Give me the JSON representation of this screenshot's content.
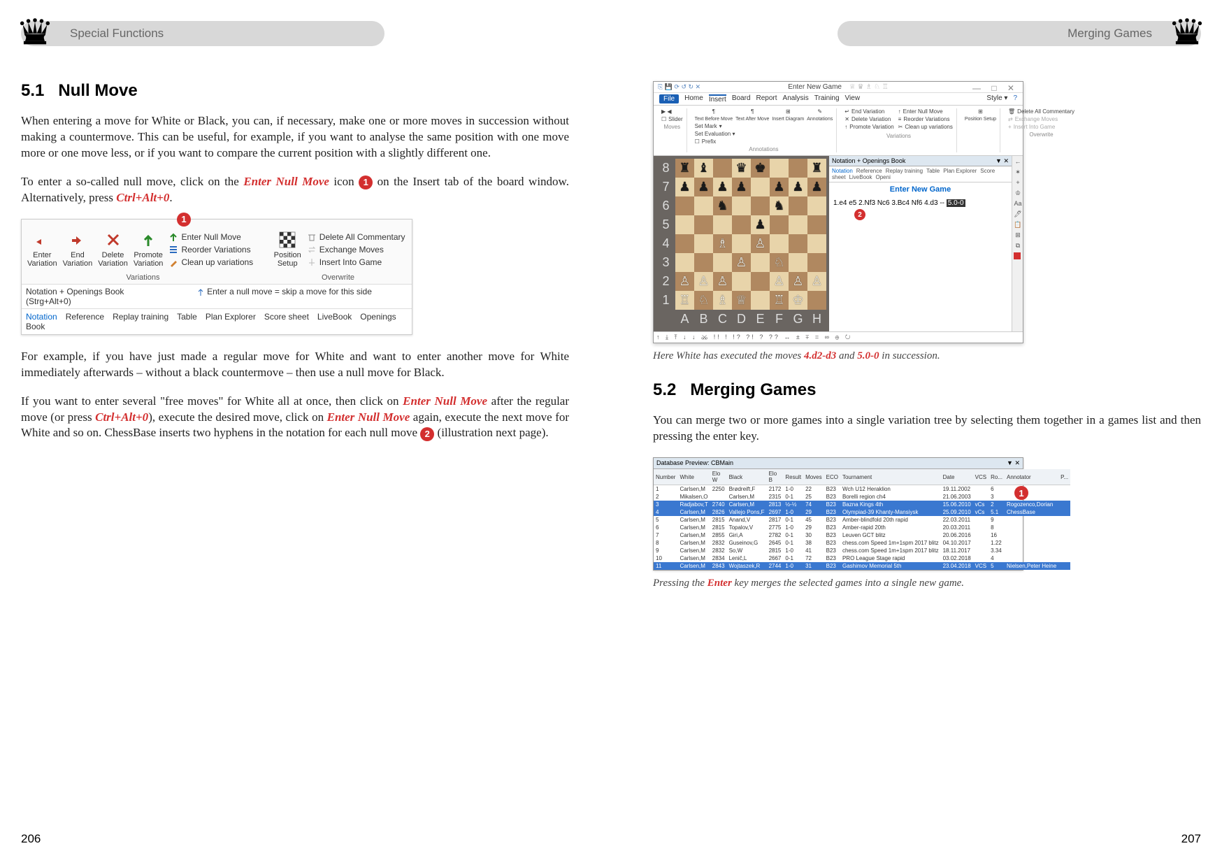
{
  "header_left": "Special Functions",
  "header_right": "Merging Games",
  "page_left": "206",
  "page_right": "207",
  "s51": {
    "num": "5.1",
    "title": "Null Move",
    "p1": "When entering a move for White or Black, you can, if necessary, make one or more moves in succession without making a countermove. This can be useful, for example, if you want to analyse the same position with one move more or one move less, or if you want to compare the current position with a slightly different one.",
    "p2_a": "To enter a so-called null move, click on the ",
    "p2_em1": "Enter Null Move",
    "p2_b": " icon ",
    "p2_c": " on the Insert tab of the board window. Alternatively, press ",
    "p2_em2": "Ctrl+Alt+0",
    "p2_d": ".",
    "p3": "For example, if you have just made a regular move for White and want to enter another move for White immediately afterwards – without a black countermove – then use a null move for Black.",
    "p4_a": "If you want to enter several \"free moves\" for White all at once, then click on ",
    "p4_em1": "Enter Null Move",
    "p4_b": " after the regular move (or press ",
    "p4_em2": "Ctrl+Alt+0",
    "p4_c": "), execute the desired move, click on ",
    "p4_em3": "Enter Null Move",
    "p4_d": " again, execute the next move for White and so on. ChessBase inserts two hyphens in the notation for each null move ",
    "p4_e": " (illustration next page)."
  },
  "toolbar": {
    "enter": "Enter\nVariation",
    "end": "End\nVariation",
    "delete": "Delete\nVariation",
    "promote": "Promote\nVariation",
    "enter_null": "Enter Null Move",
    "reorder": "Reorder Variations",
    "cleanup": "Clean up variations",
    "variations": "Variations",
    "position_setup": "Position\nSetup",
    "del_all": "Delete All Commentary",
    "exch": "Exchange Moves",
    "insert_into": "Insert Into Game",
    "overwrite": "Overwrite",
    "notation_openings": "Notation + Openings Book",
    "tip": "Enter a null move = skip a move for this side (Strg+Alt+0)",
    "tabs": [
      "Notation",
      "Reference",
      "Replay training",
      "Table",
      "Plan Explorer",
      "Score sheet",
      "LiveBook",
      "Openings Book"
    ]
  },
  "boardfig": {
    "title": "Enter New Game",
    "menu": [
      "File",
      "Home",
      "Insert",
      "Board",
      "Report",
      "Analysis",
      "Training",
      "View"
    ],
    "style": "Style ▾",
    "ribbon": {
      "slider": "Slider",
      "tbm": "Text Before Move",
      "tam": "Text After Move",
      "insd": "Insert Diagram",
      "ann_grp": "Annotations",
      "ann": "Annotations",
      "setmark": "Set Mark",
      "seteval": "Set Evaluation ▾",
      "prefix": "Prefix",
      "enter": "Enter Variation",
      "end": "End Variation",
      "del": "Delete Variation",
      "prom": "Promote Variation",
      "e_null": "Enter Null Move",
      "reord": "Reorder Variations",
      "clean": "Clean up variations",
      "var_grp": "Variations",
      "pos": "Position Setup",
      "delc": "Delete All Commentary",
      "exch": "Exchange Moves",
      "iig": "Insert Into Game",
      "ovr": "Overwrite",
      "moves": "Moves"
    },
    "not_hdr": "Notation + Openings Book",
    "not_tabs": [
      "Notation",
      "Reference",
      "Replay training",
      "Table",
      "Plan Explorer",
      "Score sheet",
      "LiveBook",
      "Openi"
    ],
    "not_title": "Enter New Game",
    "moves_a": "1.e4 e5 2.Nf3 Nc6 3.Bc4 Nf6 4.d3 -- ",
    "moves_hl": "5.0-0",
    "caption_a": "Here White has executed the moves ",
    "caption_em1": "4.d2-d3",
    "caption_b": " and ",
    "caption_em2": "5.0-0",
    "caption_c": " in succession."
  },
  "s52": {
    "num": "5.2",
    "title": "Merging Games",
    "p1": "You can merge two or more games into a single variation tree by selecting them together in a games list and then pressing the enter key.",
    "caption_a": "Pressing the ",
    "caption_em": "Enter",
    "caption_b": " key merges the selected games into a single new game."
  },
  "dbtable": {
    "title": "Database Preview: CBMain",
    "cols": [
      "Number",
      "White",
      "Elo W",
      "Black",
      "Elo B",
      "Result",
      "Moves",
      "ECO",
      "Tournament",
      "Date",
      "VCS",
      "Ro...",
      "Annotator",
      "P..."
    ],
    "rows": [
      [
        "1",
        "Carlsen,M",
        "2250",
        "Brødreift,F",
        "2172",
        "1-0",
        "22",
        "B23",
        "Wch U12 Heraklion",
        "19.11.2002",
        "",
        "6",
        "",
        ""
      ],
      [
        "2",
        "Mikalsen,O",
        "",
        "Carlsen,M",
        "2315",
        "0-1",
        "25",
        "B23",
        "Borelli region ch4",
        "21.06.2003",
        "",
        "3",
        "",
        ""
      ],
      [
        "3",
        "Radjabov,T",
        "2740",
        "Carlsen,M",
        "2813",
        "½-½",
        "74",
        "B23",
        "Bazna Kings 4th",
        "15.06.2010",
        "vCs",
        "2",
        "Rogozenco,Dorian",
        ""
      ],
      [
        "4",
        "Carlsen,M",
        "2826",
        "Vallejo Pons,F",
        "2697",
        "1-0",
        "29",
        "B23",
        "Olympiad-39 Khanty-Mansiysk",
        "25.09.2010",
        "vCs",
        "5.1",
        "ChessBase",
        ""
      ],
      [
        "5",
        "Carlsen,M",
        "2815",
        "Anand,V",
        "2817",
        "0-1",
        "45",
        "B23",
        "Amber-blindfold 20th rapid",
        "22.03.2011",
        "",
        "9",
        "",
        ""
      ],
      [
        "6",
        "Carlsen,M",
        "2815",
        "Topalov,V",
        "2775",
        "1-0",
        "29",
        "B23",
        "Amber-rapid 20th",
        "20.03.2011",
        "",
        "8",
        "",
        ""
      ],
      [
        "7",
        "Carlsen,M",
        "2855",
        "Giri,A",
        "2782",
        "0-1",
        "30",
        "B23",
        "Leuven GCT blitz",
        "20.06.2016",
        "",
        "16",
        "",
        ""
      ],
      [
        "8",
        "Carlsen,M",
        "2832",
        "Guseinov,G",
        "2645",
        "0-1",
        "38",
        "B23",
        "chess.com Speed 1m+1spm 2017 blitz",
        "04.10.2017",
        "",
        "1.22",
        "",
        ""
      ],
      [
        "9",
        "Carlsen,M",
        "2832",
        "So,W",
        "2815",
        "1-0",
        "41",
        "B23",
        "chess.com Speed 1m+1spm 2017 blitz",
        "18.11.2017",
        "",
        "3.34",
        "",
        ""
      ],
      [
        "10",
        "Carlsen,M",
        "2834",
        "Lenič,L",
        "2667",
        "0-1",
        "72",
        "B23",
        "PRO League Stage rapid",
        "03.02.2018",
        "",
        "4",
        "",
        ""
      ],
      [
        "11",
        "Carlsen,M",
        "2843",
        "Wojtaszek,R",
        "2744",
        "1-0",
        "31",
        "B23",
        "Gashimov Memorial 5th",
        "23.04.2018",
        "VCS",
        "5",
        "Nielsen,Peter Heine",
        ""
      ]
    ]
  }
}
